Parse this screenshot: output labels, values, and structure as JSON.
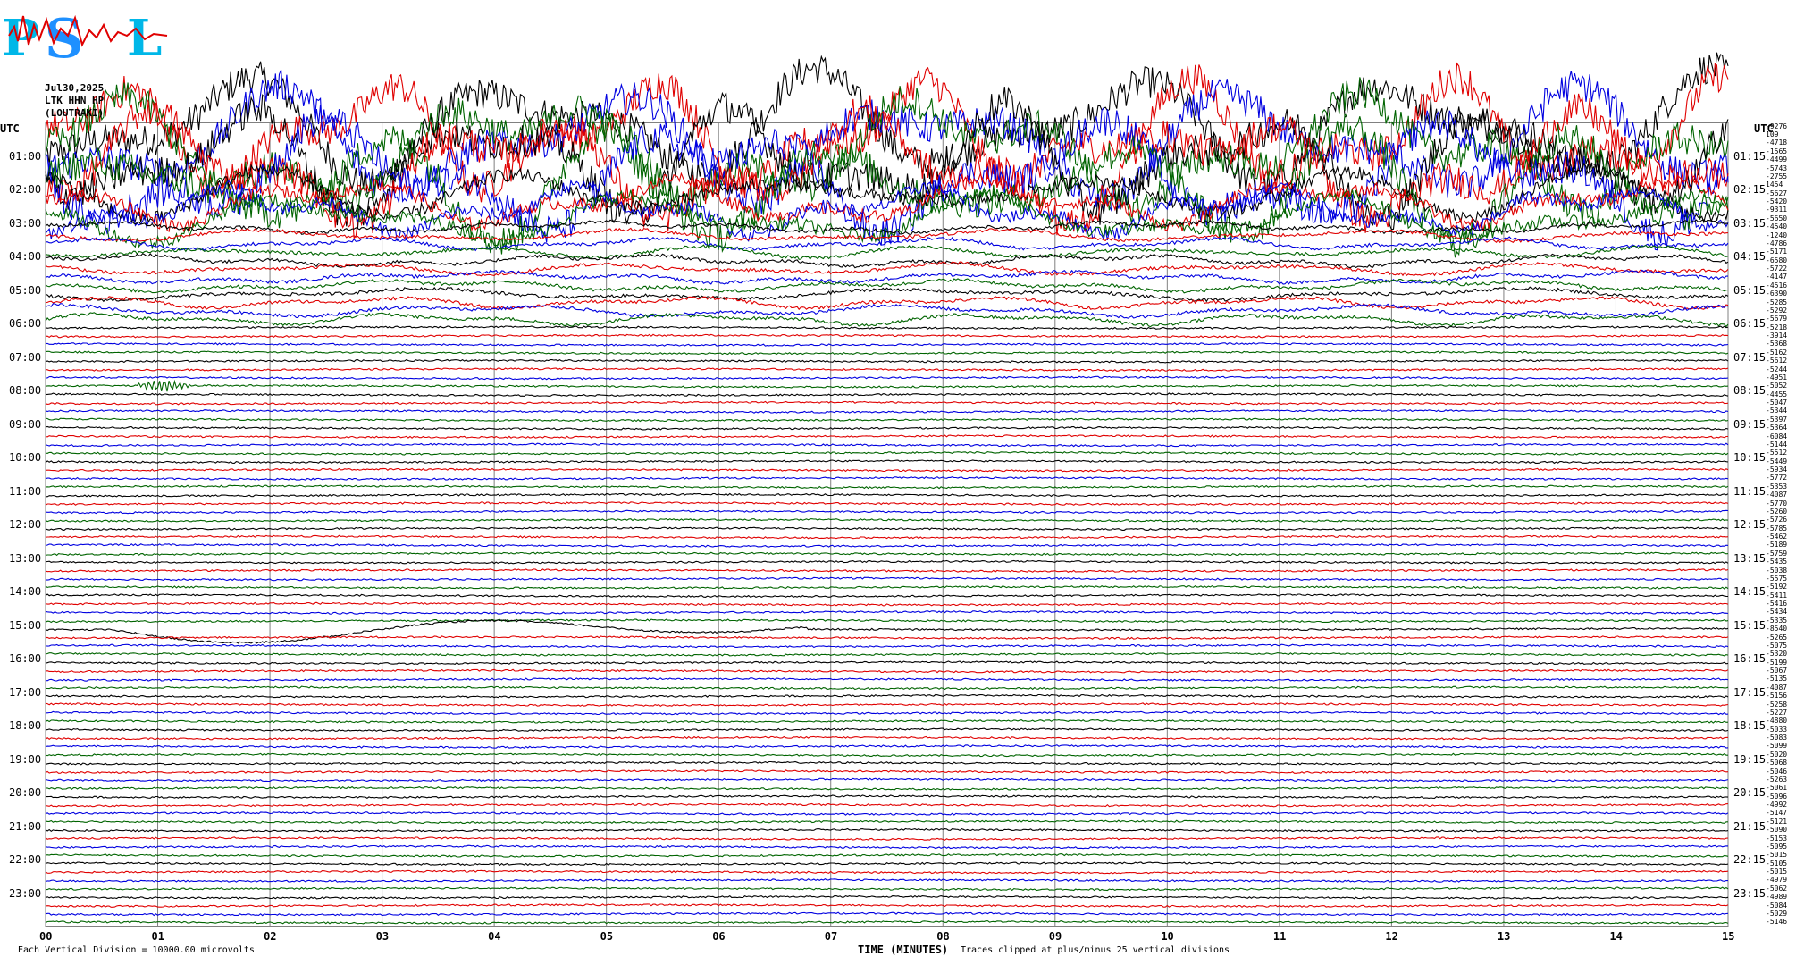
{
  "logo": {
    "text": "PSL",
    "colors": {
      "p": "#00b7e8",
      "s": "#1e90ff",
      "l": "#00b7e8",
      "scribble": "#e00000"
    }
  },
  "header": {
    "date": "Jul30,2025",
    "station": "LTK HHN HP",
    "location": "(LOUTRAKI)"
  },
  "utc_label": "UTC",
  "footer": {
    "vertical_division": "Each Vertical Division = 10000.00 microvolts",
    "xlabel": "TIME (MINUTES)",
    "clip_note": "Traces clipped at plus/minus 25 vertical divisions"
  },
  "colors": [
    "#000000",
    "#e00000",
    "#0000e0",
    "#006400"
  ],
  "chart_data": {
    "type": "line",
    "title": "",
    "xlabel": "TIME (MINUTES)",
    "xlim": [
      0,
      15
    ],
    "x_ticks": [
      "00",
      "01",
      "02",
      "03",
      "04",
      "05",
      "06",
      "07",
      "08",
      "09",
      "10",
      "11",
      "12",
      "13",
      "14",
      "15"
    ],
    "left_hour_labels": [
      "01:00",
      "02:00",
      "03:00",
      "04:00",
      "05:00",
      "06:00",
      "07:00",
      "08:00",
      "09:00",
      "10:00",
      "11:00",
      "12:00",
      "13:00",
      "14:00",
      "15:00",
      "16:00",
      "17:00",
      "18:00",
      "19:00",
      "20:00",
      "21:00",
      "22:00",
      "23:00"
    ],
    "right_hour_labels": [
      "01:15",
      "02:15",
      "03:15",
      "04:15",
      "05:15",
      "06:15",
      "07:15",
      "08:15",
      "09:15",
      "10:15",
      "11:15",
      "12:15",
      "13:15",
      "14:15",
      "15:15",
      "16:15",
      "17:15",
      "18:15",
      "19:15",
      "20:15",
      "21:15",
      "22:15",
      "23:15"
    ],
    "trace_count": 96,
    "trace_minutes": 15,
    "trace_offsets": [
      -9276,
      109,
      -4718,
      -1565,
      -4499,
      -5743,
      -2755,
      1454,
      -5627,
      -5420,
      -9311,
      -5650,
      -4540,
      -1240,
      -4786,
      -5171,
      -6580,
      -5722,
      -4147,
      -4516,
      -6390,
      -5285,
      -5292,
      -5679,
      -5218,
      -3914,
      -5368,
      -5162,
      -5612,
      -5244,
      -4951,
      -5052,
      -4455,
      -5047,
      -5344,
      -5397,
      -5364,
      -6084,
      -5144,
      -5512,
      -5449,
      -5934,
      -5772,
      -5353,
      -4087,
      -5770,
      -5260,
      -5726,
      -5785,
      -5462,
      -5189,
      -5759,
      -5435,
      -5038,
      -5575,
      -5192,
      -5411,
      -5416,
      -5434,
      -5335,
      -8540,
      -5265,
      -5075,
      -5320,
      -5199,
      -5067,
      -5135,
      -4087,
      -5156,
      -5258,
      -5227,
      -4880,
      -5033,
      -5083,
      -5099,
      -5020,
      -5068,
      -5046,
      -5263,
      -5061,
      -5096,
      -4992,
      -5147,
      -5121,
      -5090,
      -5153,
      -5095,
      -5015,
      -5105,
      -5015,
      -4979,
      -5062,
      -4989,
      -5084,
      -5029,
      -5146
    ],
    "vertical_division_microvolts": 10000,
    "clip_divisions": 25,
    "notable_events": [
      {
        "trace_hour": "00:00-06:00",
        "description_level": "high amplitude clipped traces"
      },
      {
        "trace_hour": "07:45",
        "minute": 1.0,
        "type": "small burst"
      },
      {
        "trace_hour": "15:00",
        "minute_range": [
          0.8,
          6.5
        ],
        "type": "long-period excursion"
      }
    ]
  }
}
